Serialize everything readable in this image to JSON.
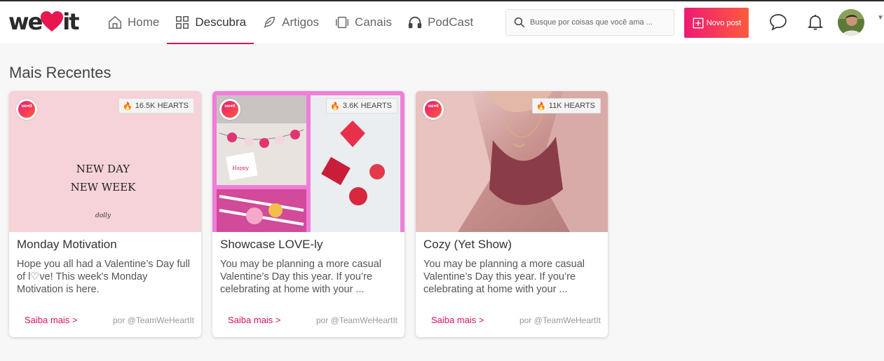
{
  "brand": {
    "logo_left": "we",
    "logo_right": "it",
    "accent": "#d6145f",
    "gradient_start": "#ee1a73",
    "gradient_end": "#fe5b3e"
  },
  "nav": {
    "items": [
      {
        "label": "Home",
        "icon": "home-icon"
      },
      {
        "label": "Descubra",
        "icon": "grid-icon",
        "active": true
      },
      {
        "label": "Artigos",
        "icon": "feather-icon"
      },
      {
        "label": "Canais",
        "icon": "channels-icon"
      },
      {
        "label": "PodCast",
        "icon": "headphones-icon"
      }
    ]
  },
  "search": {
    "placeholder": "Busque por coisas que você ama ..."
  },
  "new_post": {
    "label": "Novo post"
  },
  "header_icons": [
    "chat-bubble-icon",
    "bell-icon",
    "avatar",
    "caret-down-icon"
  ],
  "section": {
    "title": "Mais Recentes"
  },
  "cards": [
    {
      "hearts": "16.5K HEARTS",
      "title": "Monday Motivation",
      "excerpt": "Hope you all had a Valentine’s Day full of l♡ve! This week's Monday Motivation is here.",
      "more": "Saiba mais >",
      "author": "por @TeamWeHeartIt",
      "image_text_line1": "NEW DAY",
      "image_text_line2": "NEW WEEK",
      "image_signature": "dolly"
    },
    {
      "hearts": "3.6K HEARTS",
      "title": "Showcase LOVE-ly",
      "excerpt": "You may be planning a more casual Valentine’s Day this year. If you’re celebrating at home with your ...",
      "more": "Saiba mais >",
      "author": "por @TeamWeHeartIt"
    },
    {
      "hearts": "11K HEARTS",
      "title": "Cozy (Yet Show)",
      "excerpt": "You may be planning a more casual Valentine’s Day this year. If you’re celebrating at home with your ...",
      "more": "Saiba mais >",
      "author": "por @TeamWeHeartIt"
    }
  ]
}
